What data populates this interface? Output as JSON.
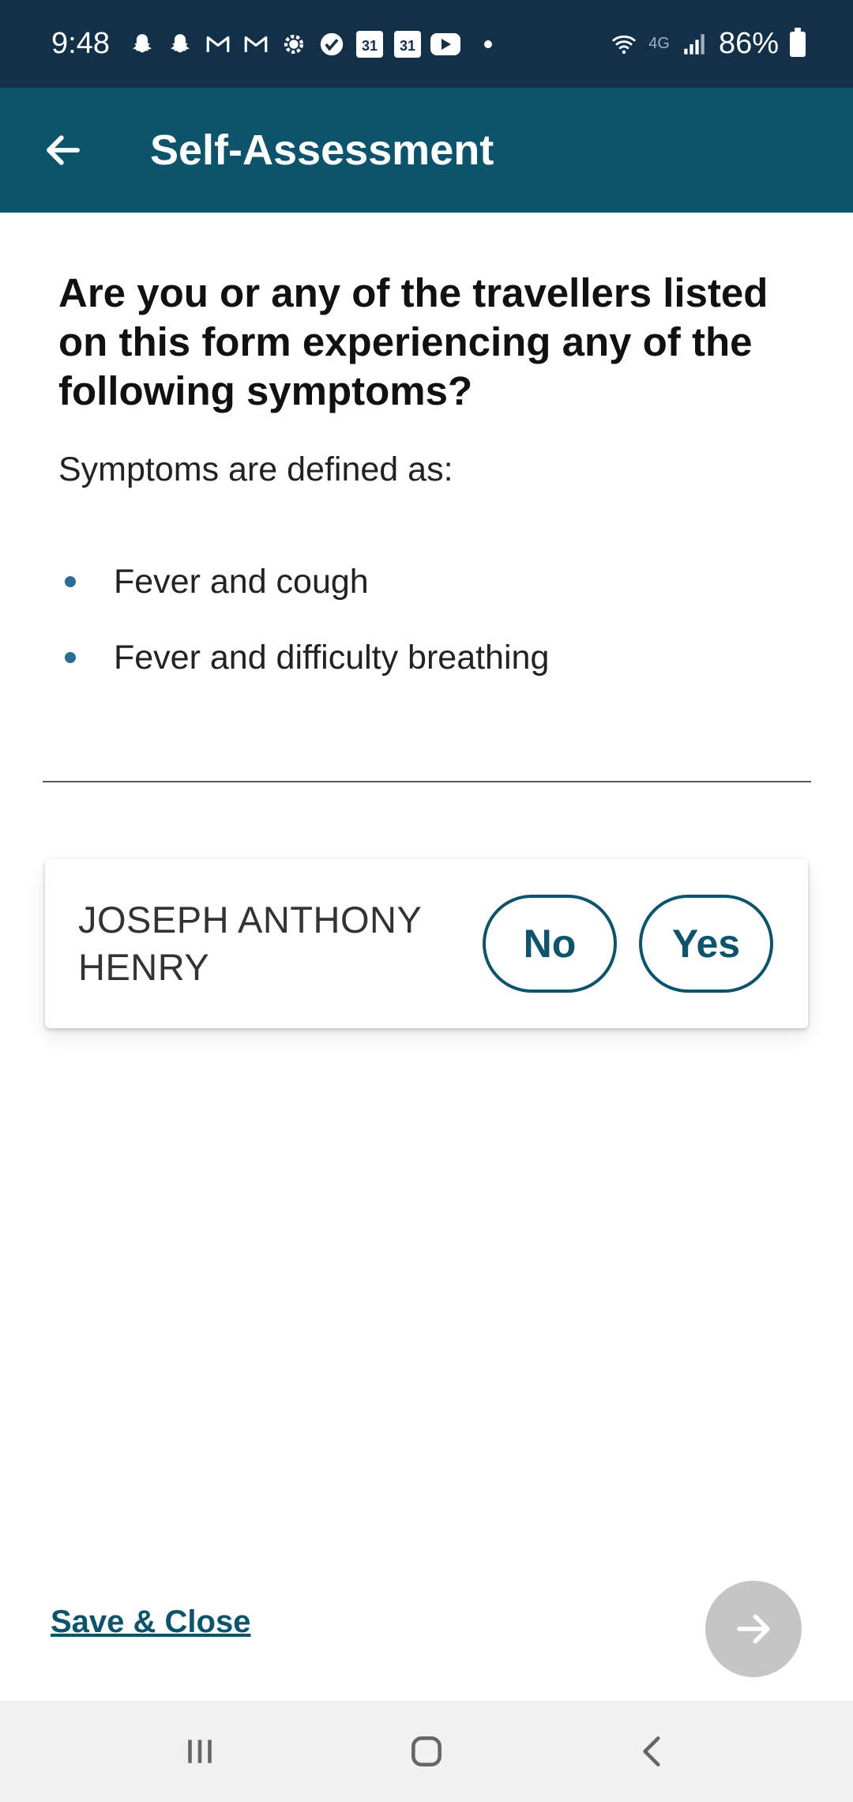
{
  "status_bar": {
    "time": "9:48",
    "network": "4G",
    "battery": "86%",
    "calendar_day_1": "31",
    "calendar_day_2": "31",
    "icons": [
      "snapchat-icon",
      "snapchat-icon",
      "gmail-icon",
      "gmail-icon",
      "settings-gear-icon",
      "check-badge-icon",
      "calendar-icon",
      "calendar-icon",
      "youtube-icon",
      "wifi-icon",
      "signal-icon",
      "battery-icon"
    ]
  },
  "app_bar": {
    "title": "Self-Assessment",
    "back_icon": "arrow-left-icon"
  },
  "content": {
    "question": "Are you or any of the travellers listed on this form experiencing any of the following symptoms?",
    "definition_label": "Symptoms are defined as:",
    "symptoms": [
      "Fever and cough",
      "Fever and difficulty breathing"
    ]
  },
  "traveller": {
    "name": "JOSEPH ANTHONY HENRY",
    "no_label": "No",
    "yes_label": "Yes"
  },
  "footer": {
    "save_close_label": "Save & Close",
    "next_icon": "arrow-right-icon"
  },
  "colors": {
    "status_bar": "#133049",
    "app_bar": "#0e536c",
    "accent": "#0e536c",
    "bullet": "#2b6d95",
    "next_disabled": "#c5c5c5"
  }
}
